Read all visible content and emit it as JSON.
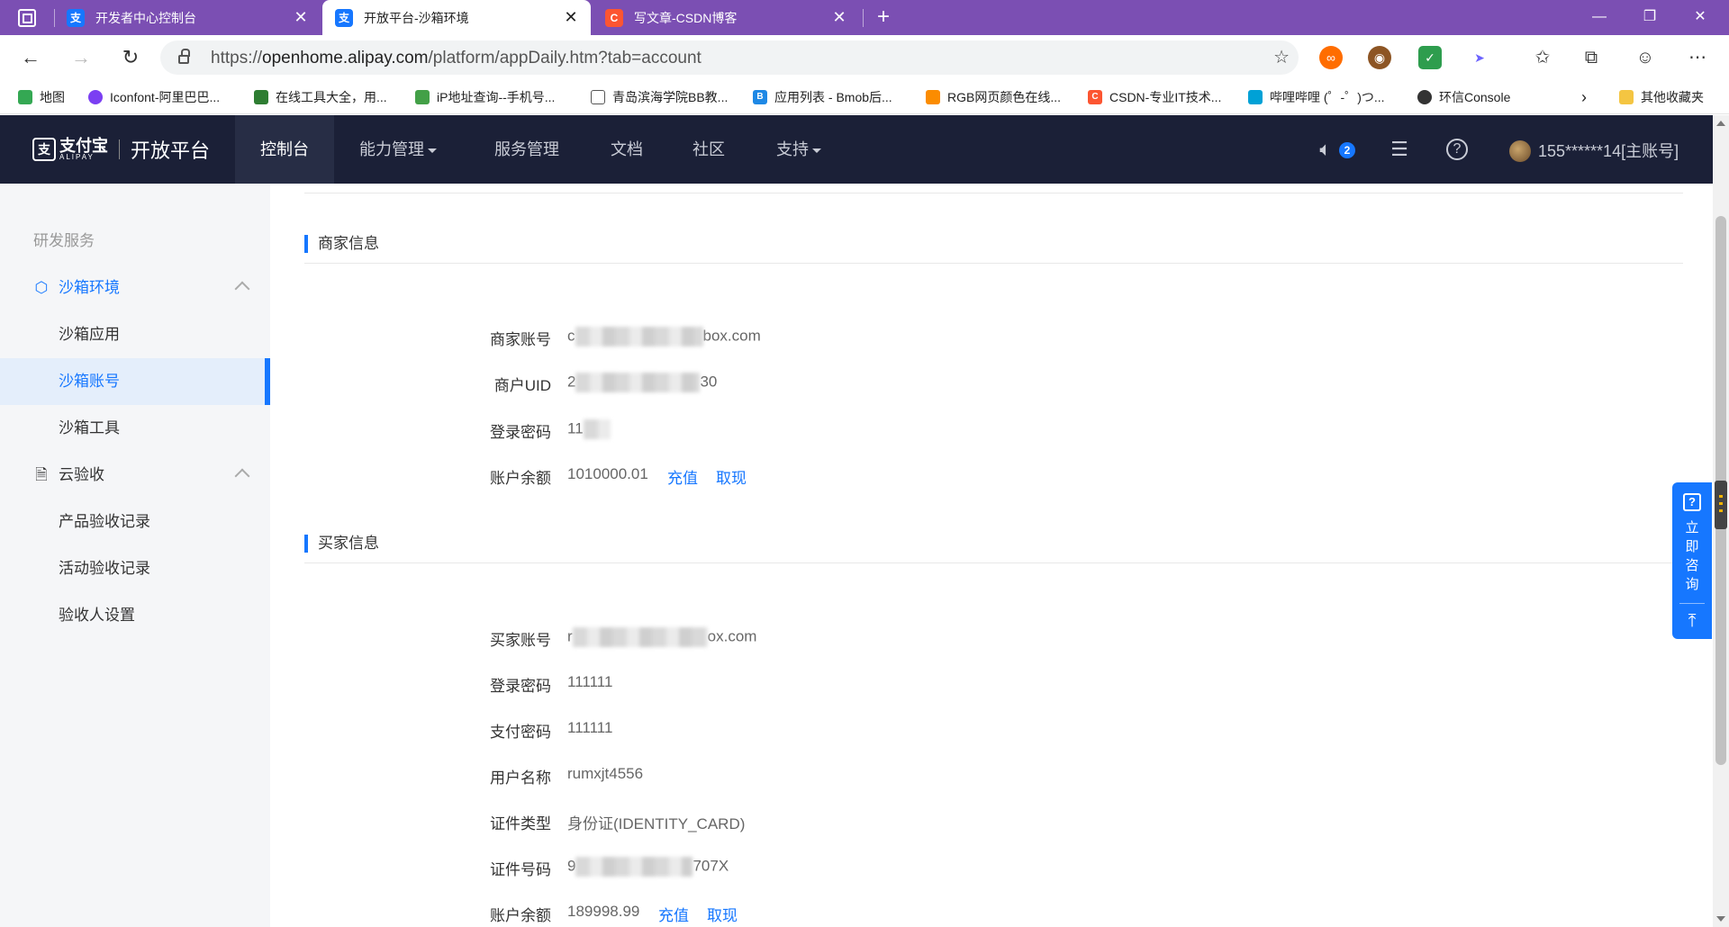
{
  "browser": {
    "tabs": [
      {
        "title": "开发者中心控制台",
        "favicon": "支",
        "color": "#1677ff",
        "active": false
      },
      {
        "title": "开放平台-沙箱环境",
        "favicon": "支",
        "color": "#1677ff",
        "active": true
      },
      {
        "title": "写文章-CSDN博客",
        "favicon": "C",
        "color": "#fc5531",
        "active": false
      }
    ],
    "close_glyph": "✕",
    "newtab_glyph": "+",
    "window_controls": {
      "minimize": "—",
      "restore": "❐",
      "close": "✕"
    },
    "url": {
      "prefix": "https://",
      "host": "openhome.alipay.com",
      "path": "/platform/appDaily.htm?tab=account"
    },
    "bookmarks": [
      {
        "label": "地图",
        "color": "#34a853"
      },
      {
        "label": "Iconfont-阿里巴巴...",
        "color": "#7b3ff2"
      },
      {
        "label": "在线工具大全，用...",
        "color": "#2e7d32"
      },
      {
        "label": "iP地址查询--手机号...",
        "color": "#43a047"
      },
      {
        "label": "青岛滨海学院BB教...",
        "color": "#9e9e9e"
      },
      {
        "label": "应用列表 - Bmob后...",
        "color": "#1e88e5"
      },
      {
        "label": "RGB网页颜色在线...",
        "color": "#fb8c00"
      },
      {
        "label": "CSDN-专业IT技术...",
        "color": "#fc5531"
      },
      {
        "label": "哔哩哔哩 (゜-゜)つ...",
        "color": "#00a1d6"
      },
      {
        "label": "环信Console",
        "color": "#333333"
      }
    ],
    "other_bookmarks": "其他收藏夹"
  },
  "header": {
    "logo_name": "支付宝",
    "logo_sub": "ALIPAY",
    "title": "开放平台",
    "nav": [
      "控制台",
      "能力管理",
      "服务管理",
      "文档",
      "社区",
      "支持"
    ],
    "notice_count": "2",
    "user": "155******14[主账号]"
  },
  "sidebar": {
    "group": "研发服务",
    "sandbox": {
      "label": "沙箱环境",
      "items": [
        "沙箱应用",
        "沙箱账号",
        "沙箱工具"
      ]
    },
    "cloud": {
      "label": "云验收",
      "items": [
        "产品验收记录",
        "活动验收记录",
        "验收人设置"
      ]
    }
  },
  "merchant": {
    "title": "商家信息",
    "account_label": "商家账号",
    "account_head": "c",
    "account_tail": "box.com",
    "uid_label": "商户UID",
    "uid_head": "2",
    "uid_tail": "30",
    "password_label": "登录密码",
    "password_head": "11",
    "balance_label": "账户余额",
    "balance": "1010000.01",
    "recharge": "充值",
    "withdraw": "取现"
  },
  "buyer": {
    "title": "买家信息",
    "account_label": "买家账号",
    "account_head": "r",
    "account_tail": "ox.com",
    "login_password_label": "登录密码",
    "login_password": "111111",
    "pay_password_label": "支付密码",
    "pay_password": "111111",
    "username_label": "用户名称",
    "username": "rumxjt4556",
    "id_type_label": "证件类型",
    "id_type": "身份证(IDENTITY_CARD)",
    "id_no_label": "证件号码",
    "id_no_head": "9",
    "id_no_tail": "707X",
    "balance_label": "账户余额",
    "balance": "189998.99",
    "recharge": "充值",
    "withdraw": "取现"
  },
  "consult": {
    "label": "立即咨询",
    "top": "⤒"
  },
  "colors": {
    "brand_blue": "#1677ff",
    "header_bg": "#1b2037",
    "tab_strip": "#7b4fb3"
  }
}
